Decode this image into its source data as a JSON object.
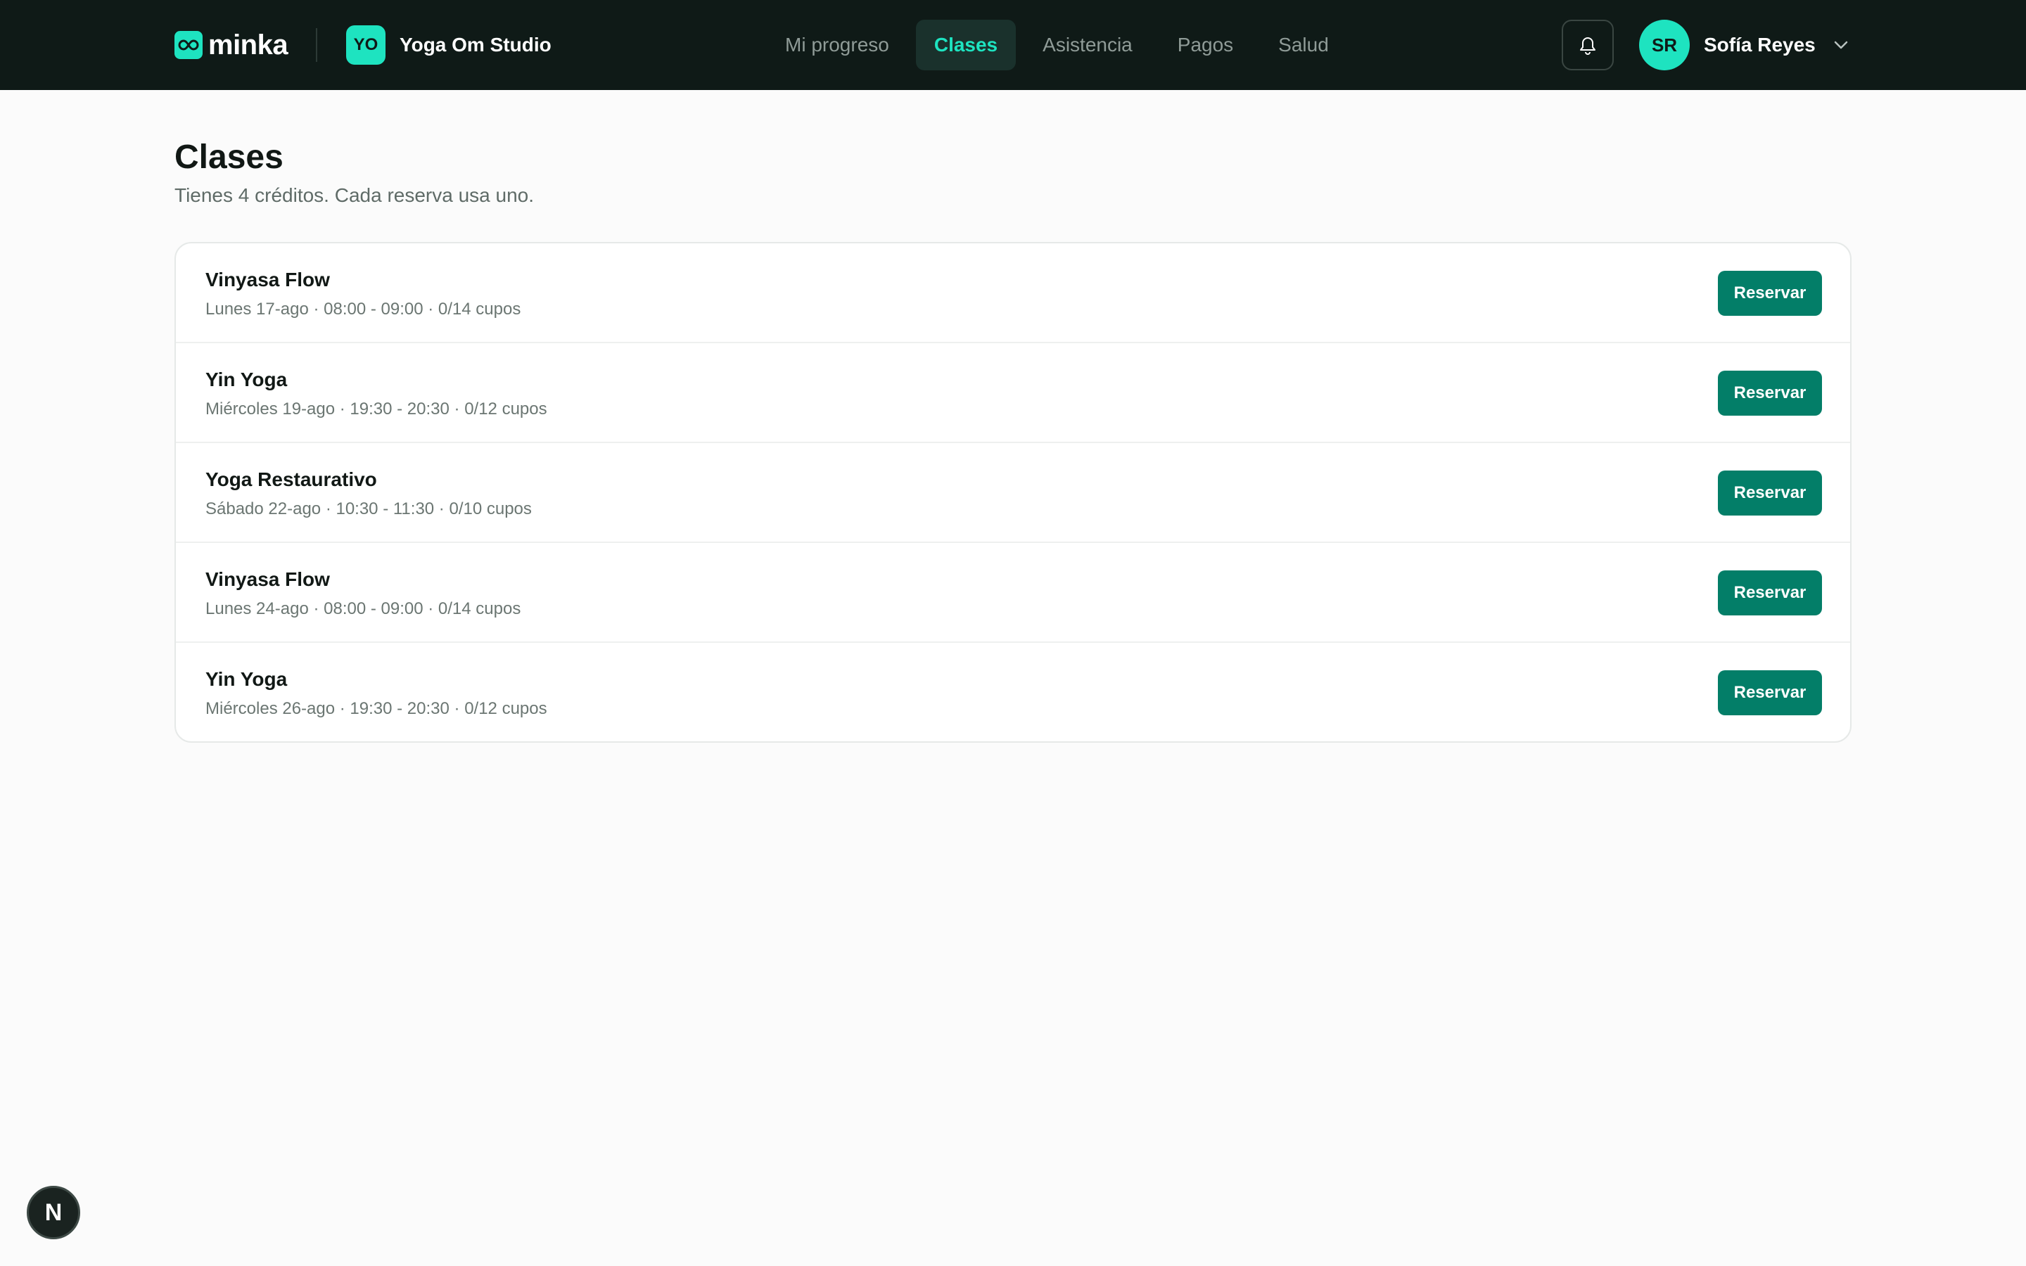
{
  "header": {
    "brand": "minka",
    "studio_initials": "YO",
    "studio_name": "Yoga Om Studio",
    "nav": [
      {
        "label": "Mi progreso",
        "active": false
      },
      {
        "label": "Clases",
        "active": true
      },
      {
        "label": "Asistencia",
        "active": false
      },
      {
        "label": "Pagos",
        "active": false
      },
      {
        "label": "Salud",
        "active": false
      }
    ],
    "user_initials": "SR",
    "user_name": "Sofía Reyes"
  },
  "main": {
    "title": "Clases",
    "subtitle": "Tienes 4 créditos. Cada reserva usa uno.",
    "classes": [
      {
        "name": "Vinyasa Flow",
        "meta": "Lunes 17-ago · 08:00 - 09:00 · 0/14 cupos",
        "action": "Reservar"
      },
      {
        "name": "Yin Yoga",
        "meta": "Miércoles 19-ago · 19:30 - 20:30 · 0/12 cupos",
        "action": "Reservar"
      },
      {
        "name": "Yoga Restaurativo",
        "meta": "Sábado 22-ago · 10:30 - 11:30 · 0/10 cupos",
        "action": "Reservar"
      },
      {
        "name": "Vinyasa Flow",
        "meta": "Lunes 24-ago · 08:00 - 09:00 · 0/14 cupos",
        "action": "Reservar"
      },
      {
        "name": "Yin Yoga",
        "meta": "Miércoles 26-ago · 19:30 - 20:30 · 0/12 cupos",
        "action": "Reservar"
      }
    ]
  },
  "dev_badge": "N",
  "colors": {
    "topbar": "#0f1a17",
    "accent": "#1ee3c0",
    "button": "#037e68",
    "background": "#fbfbfb"
  },
  "icons": {
    "brand": "infinity-link-icon",
    "notifications": "bell-icon",
    "user_menu": "chevron-down-icon"
  }
}
